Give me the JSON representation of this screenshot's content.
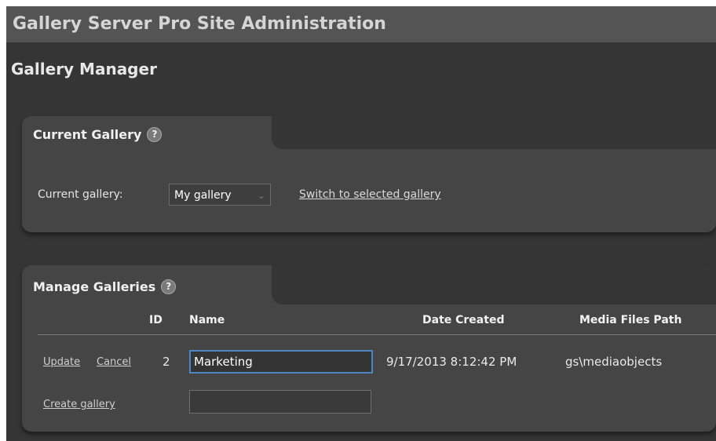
{
  "header": {
    "title": "Gallery Server Pro Site Administration"
  },
  "page": {
    "title": "Gallery Manager"
  },
  "current_gallery": {
    "heading": "Current Gallery",
    "help_glyph": "?",
    "label": "Current gallery:",
    "selected": "My gallery",
    "switch_link": "Switch to selected gallery"
  },
  "manage": {
    "heading": "Manage Galleries",
    "help_glyph": "?",
    "columns": {
      "id": "ID",
      "name": "Name",
      "date": "Date Created",
      "path": "Media Files Path"
    },
    "row": {
      "update": "Update",
      "cancel": "Cancel",
      "id": "2",
      "name": "Marketing",
      "date": "9/17/2013 8:12:42 PM",
      "path": "gs\\mediaobjects"
    },
    "create_link": "Create gallery",
    "new_name": ""
  },
  "colors": {
    "focus": "#4e86c4",
    "header_bg": "#545454",
    "page_bg": "#353535",
    "panel_bg": "#454545"
  }
}
